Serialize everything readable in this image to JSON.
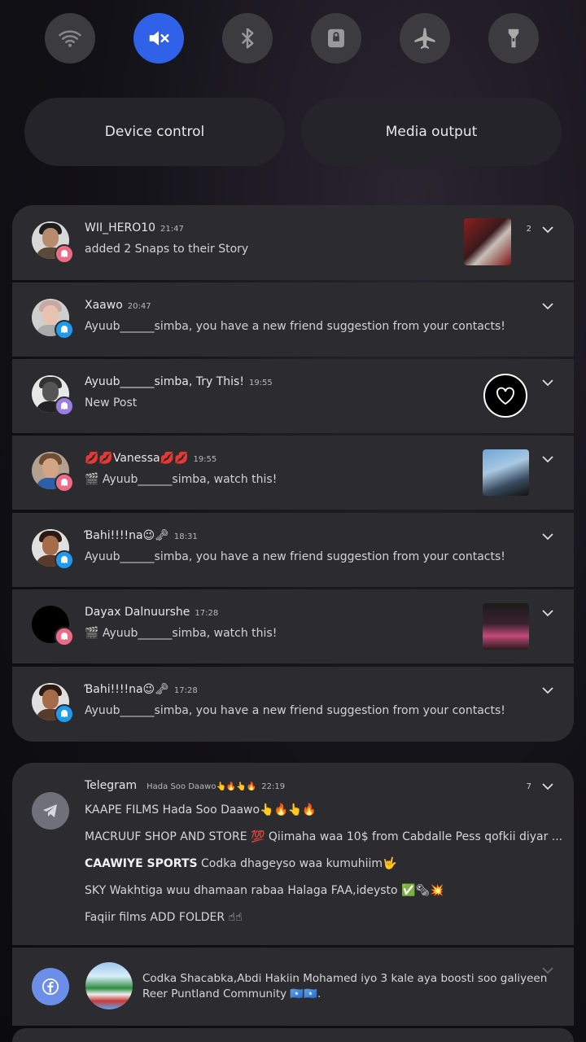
{
  "quick_settings": [
    {
      "name": "wifi",
      "active": false
    },
    {
      "name": "mute",
      "active": true
    },
    {
      "name": "bluetooth",
      "active": false
    },
    {
      "name": "rotation-lock",
      "active": false
    },
    {
      "name": "airplane-mode",
      "active": false
    },
    {
      "name": "flashlight",
      "active": false
    }
  ],
  "pills": {
    "device_control": "Device control",
    "media_output": "Media output"
  },
  "notifications": [
    {
      "sender": "WII_HERO10",
      "time": "21:47",
      "body": "added 2 Snaps to their Story",
      "count": "2",
      "badge_color": "#f06a86"
    },
    {
      "sender": "Xaawo",
      "time": "20:47",
      "body": "Ayuub______simba, you have a new friend suggestion from your contacts!",
      "badge_color": "#1e9af1"
    },
    {
      "sender": "Ayuub______simba, Try This!",
      "time": "19:55",
      "body": "New Post",
      "badge_color": "#9a7ee6"
    },
    {
      "sender": "💋💋Vanessa💋💋",
      "time": "19:55",
      "body": "🎬 Ayuub______simba, watch this!",
      "badge_color": "#f06a86"
    },
    {
      "sender": "Ɓahi!!!!na😉🗝",
      "time": "18:31",
      "body": "Ayuub______simba, you have a new friend suggestion from your contacts!",
      "badge_color": "#1e9af1"
    },
    {
      "sender": "Dayax Dalnuurshe",
      "time": "17:28",
      "body": "🎬 Ayuub______simba, watch this!",
      "badge_color": "#f06a86"
    },
    {
      "sender": "Ɓahi!!!!na😉🗝",
      "time": "17:28",
      "body": "Ayuub______simba, you have a new friend suggestion from your contacts!",
      "badge_color": "#1e9af1"
    }
  ],
  "telegram": {
    "app": "Telegram",
    "subtitle": "Hada Soo Daawo👆🔥👆🔥",
    "time": "22:19",
    "count": "7",
    "lines": [
      {
        "sender": "KAAPE FILMS",
        "text": "Hada Soo Daawo👆🔥👆🔥"
      },
      {
        "sender": "MACRUUF SHOP AND STORE",
        "text": "💯 Qiimaha waa 10$ from Cabdalle Pess qofkii diyar ..."
      },
      {
        "sender": "CAAWIYE SPORTS",
        "text": "Codka dhageyso waa kumuhiim🤟"
      },
      {
        "sender": "SKY",
        "text": "Wakhtiga wuu dhamaan rabaa Halaga FAA,ideysto ✅🗞💥"
      },
      {
        "sender": "Faqiir films",
        "text": "ADD FOLDER ☝☝"
      }
    ]
  },
  "facebook": {
    "line1": "Codka Shacabka,Abdi Hakiin Mohamed iyo 3 kale aya boosti soo galiyeen",
    "line2": "Reer Puntland Community 🇸🇴🇸🇴."
  },
  "colors": {
    "accent": "#2f62e8",
    "card": "#2c2c30"
  }
}
